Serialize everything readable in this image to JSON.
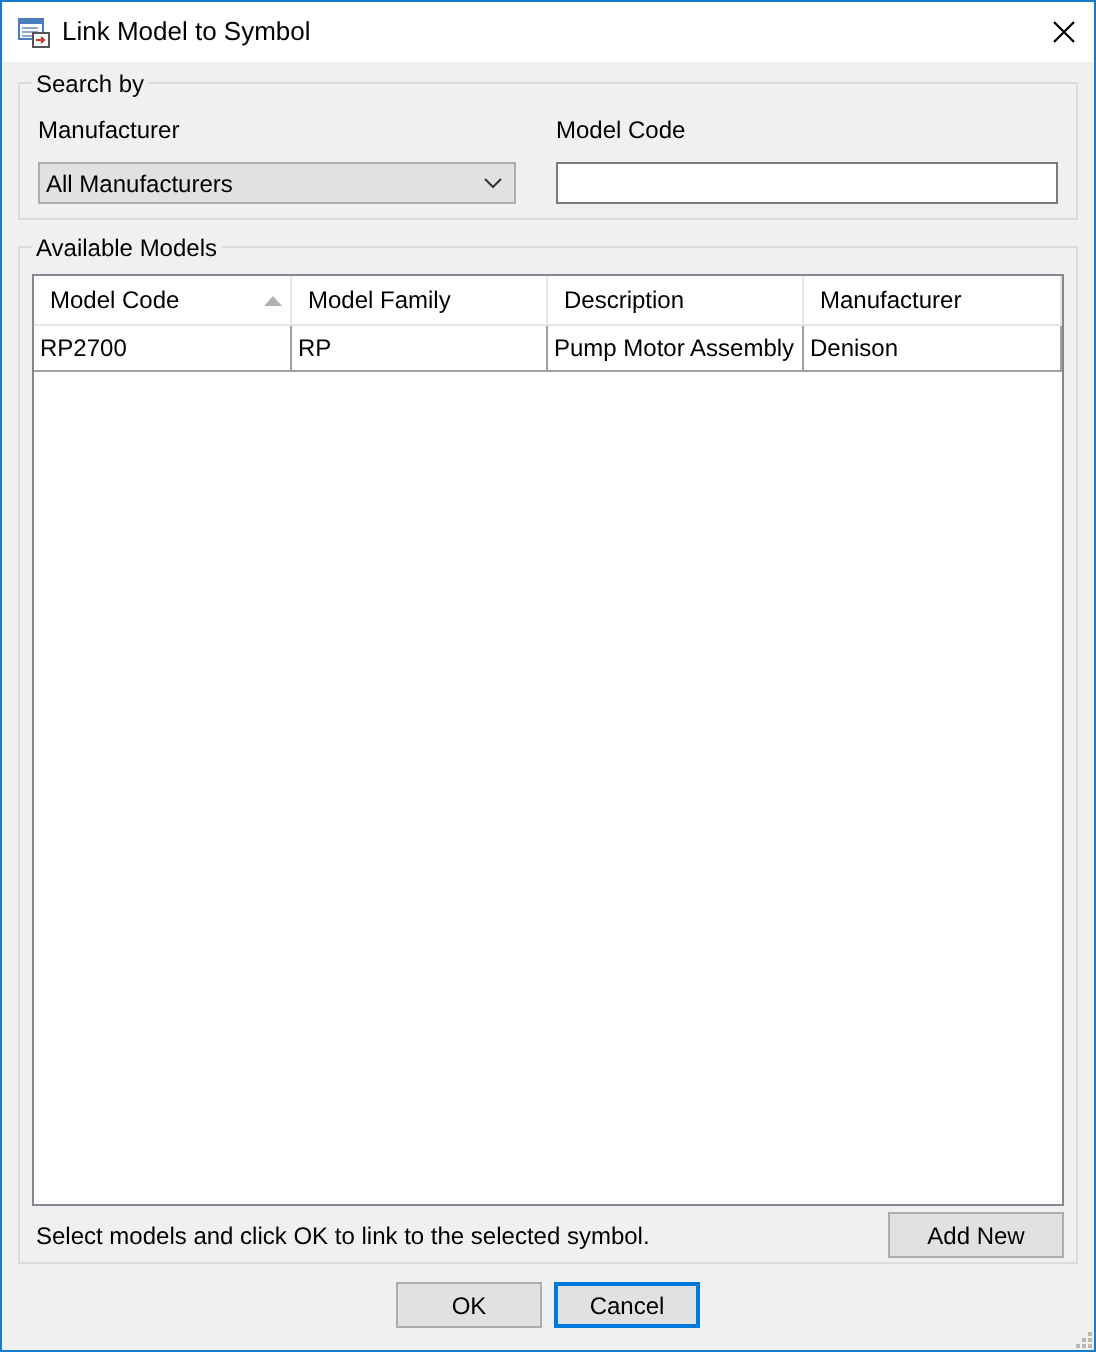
{
  "window": {
    "title": "Link Model to Symbol"
  },
  "search_by": {
    "title": "Search by",
    "manufacturer": {
      "label": "Manufacturer",
      "value": "All Manufacturers"
    },
    "model_code": {
      "label": "Model Code"
    }
  },
  "available_models": {
    "title": "Available Models",
    "table": {
      "columns": [
        {
          "label": "Model Code",
          "sorted": true
        },
        {
          "label": "Model Family",
          "sorted": false
        },
        {
          "label": "Description",
          "sorted": false
        },
        {
          "label": "Manufacturer",
          "sorted": false
        }
      ],
      "rows": [
        [
          "RP2700",
          "RP",
          "Pump Motor Assembly",
          "Denison"
        ]
      ]
    },
    "hint": "Select models and click OK to link to the selected symbol.",
    "add_button": "Add New"
  },
  "buttons": [
    {
      "label": "OK",
      "focused": false
    },
    {
      "label": "Cancel",
      "focused": true
    }
  ]
}
